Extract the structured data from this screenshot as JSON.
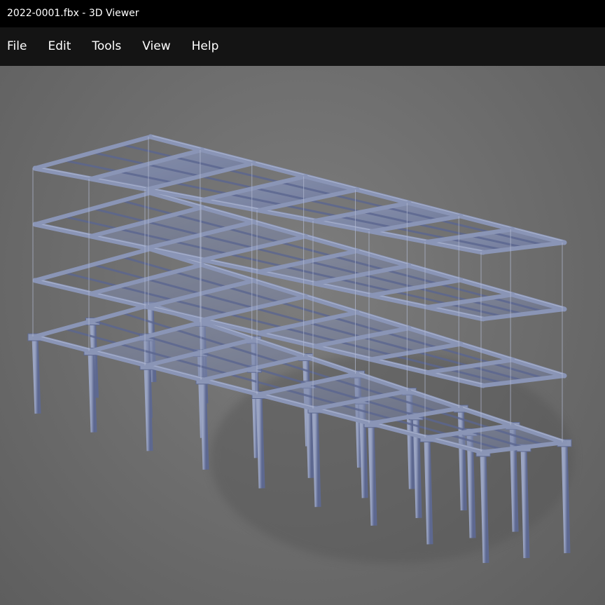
{
  "window": {
    "title": "2022-0001.fbx - 3D Viewer"
  },
  "menu": {
    "items": [
      {
        "label": "File"
      },
      {
        "label": "Edit"
      },
      {
        "label": "Tools"
      },
      {
        "label": "View"
      },
      {
        "label": "Help"
      }
    ]
  },
  "viewport": {
    "model": "structural-frame-3d-model",
    "background_color": "#6f6f6f",
    "model_color": "#7b87ab"
  }
}
